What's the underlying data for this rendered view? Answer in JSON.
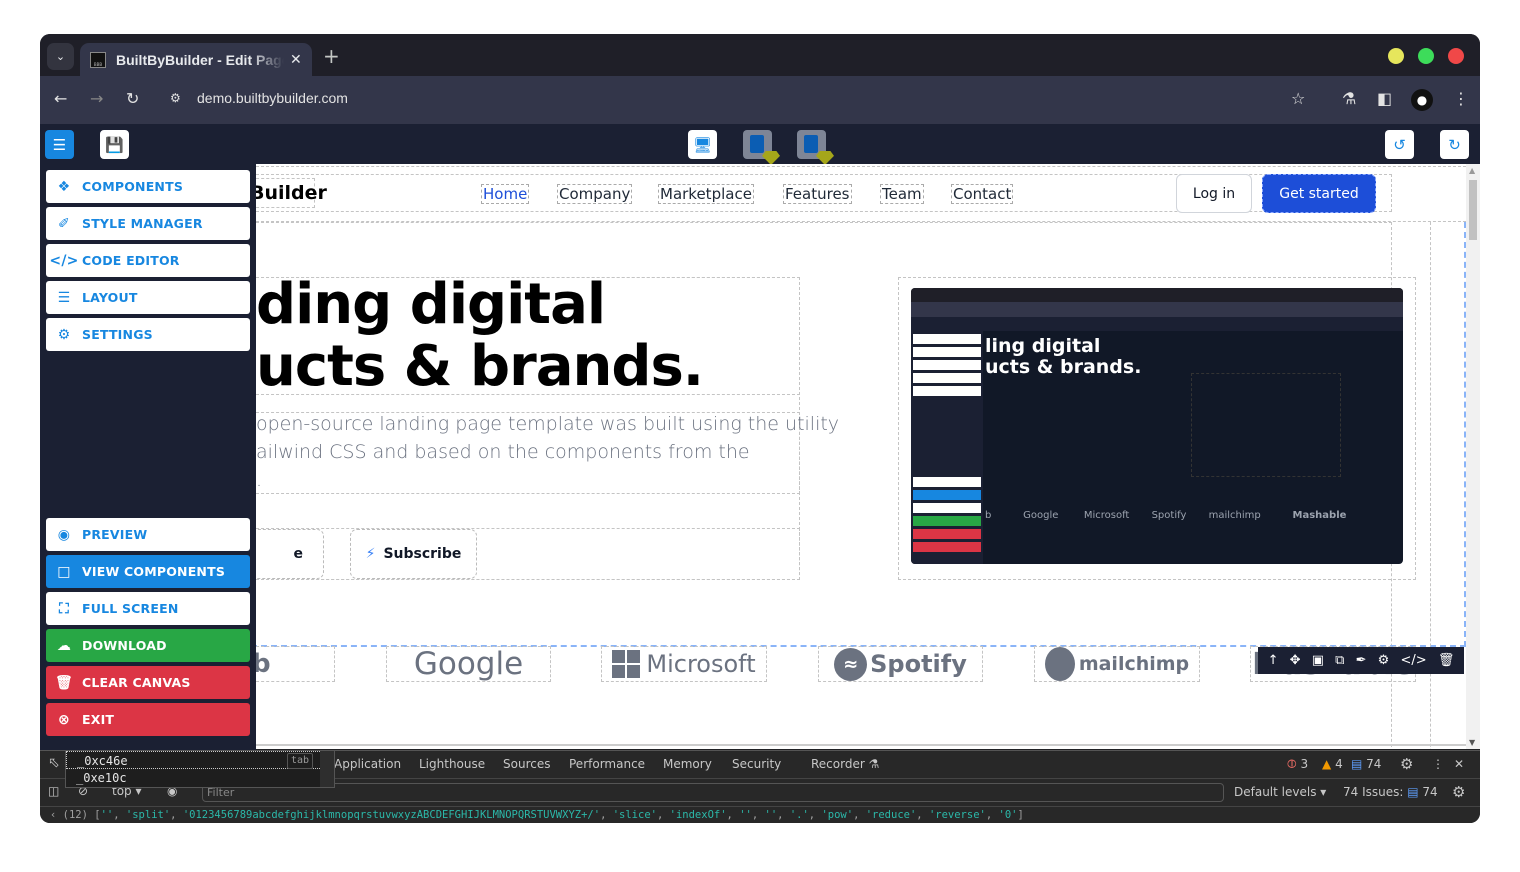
{
  "browser": {
    "tab_title": "BuiltByBuilder - Edit Page",
    "tab_favicon_text": "BBB",
    "url": "demo.builtbybuilder.com",
    "window_controls": {
      "minimize_color": "#e6e65c",
      "maximize_color": "#3ddc5a",
      "close_color": "#f04848"
    }
  },
  "builder_toolbar": {
    "panel_toggle_icon": "sliders-icon",
    "save_icon": "floppy-disk-icon",
    "devices": [
      "desktop",
      "tablet",
      "mobile"
    ],
    "undo_icon": "undo-icon",
    "redo_icon": "redo-icon"
  },
  "side_panel": {
    "top_items": [
      {
        "label": "COMPONENTS",
        "icon": "cubes-icon"
      },
      {
        "label": "STYLE MANAGER",
        "icon": "paintbrush-icon"
      },
      {
        "label": "CODE EDITOR",
        "icon": "code-icon"
      },
      {
        "label": "LAYOUT",
        "icon": "layers-icon"
      },
      {
        "label": "SETTINGS",
        "icon": "gear-icon"
      }
    ],
    "bottom_items": [
      {
        "label": "PREVIEW",
        "icon": "eye-icon"
      },
      {
        "label": "VIEW COMPONENTS",
        "icon": "square-icon"
      },
      {
        "label": "FULL SCREEN",
        "icon": "expand-icon"
      },
      {
        "label": "DOWNLOAD",
        "icon": "cloud-download-icon"
      },
      {
        "label": "CLEAR CANVAS",
        "icon": "trash-icon"
      },
      {
        "label": "EXIT",
        "icon": "close-circle-icon"
      }
    ],
    "colors": {
      "accent": "#1787e0",
      "download": "#28a745",
      "danger": "#dc3545",
      "panel_bg": "#1b2033"
    }
  },
  "canvas": {
    "logo_text": "Builder",
    "nav": [
      "Home",
      "Company",
      "Marketplace",
      "Features",
      "Team",
      "Contact"
    ],
    "login_label": "Log in",
    "cta_label": "Get started",
    "hero": {
      "title_line1": "ding digital",
      "title_line2": "ucts & brands.",
      "description_line1": "open-source landing page template was built using the utility",
      "description_line2": "ailwind CSS and based on the components from the",
      "description_line3": ".",
      "button1_label": "e",
      "button2_label": "Subscribe"
    },
    "brands": [
      "b",
      "Google",
      "Microsoft",
      "Spotify",
      "mailchimp",
      "Mashable"
    ],
    "element_toolbar_icons": [
      "arrow-up-icon",
      "move-icon",
      "image-icon",
      "copy-icon",
      "pen-icon",
      "gear-icon",
      "code-icon",
      "trash-icon"
    ]
  },
  "devtools": {
    "tabs": [
      "Application",
      "Lighthouse",
      "Sources",
      "Performance",
      "Memory",
      "Security",
      "Recorder"
    ],
    "errors": "3",
    "warnings": "4",
    "messages": "74",
    "context": "top",
    "filter_placeholder": "Filter",
    "levels": "Default levels",
    "issues_label": "74 Issues:",
    "issues_count": "74",
    "autocomplete": [
      "_0xc46e",
      "_0xe10c"
    ],
    "autocomplete_hint": "tab",
    "console_prefix": "(12) [",
    "console_items": [
      "''",
      "'split'",
      "'0123456789abcdefghijklmnopqrstuvwxyzABCDEFGHIJKLMNOPQRSTUVWXYZ+/'",
      "'slice'",
      "'indexOf'",
      "''",
      "''",
      "'.'",
      "'pow'",
      "'reduce'",
      "'reverse'",
      "'0'"
    ]
  }
}
